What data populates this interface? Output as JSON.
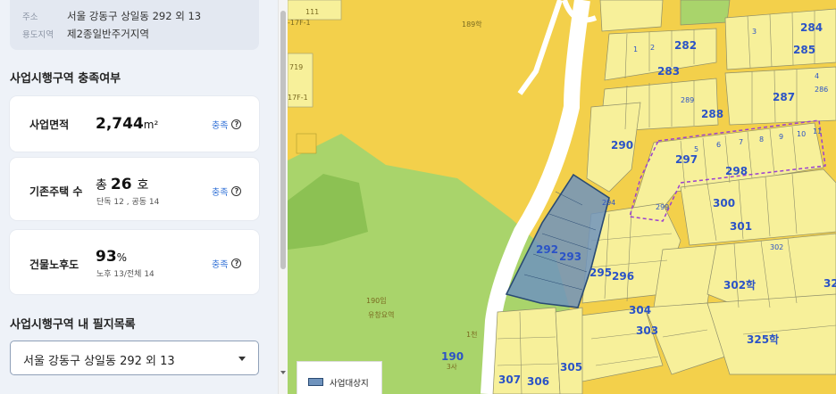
{
  "info": {
    "address_key": "주소",
    "address_value": "서울 강동구 상일동 292 외 13",
    "zoning_key": "용도지역",
    "zoning_value": "제2종일반주거지역"
  },
  "section1_title": "사업시행구역 충족여부",
  "stats": [
    {
      "label": "사업면적",
      "value": "2,744",
      "unit": "m²",
      "status": "충족"
    },
    {
      "label": "기존주택 수",
      "prefix": "총",
      "value": "26",
      "unit": "호",
      "sub": "단독 12 , 공동 14",
      "status": "충족"
    },
    {
      "label": "건물노후도",
      "value": "93",
      "unit": "%",
      "sub": "노후 13/전체 14",
      "status": "충족"
    }
  ],
  "help_glyph": "?",
  "section2_title": "사업시행구역 내 필지목록",
  "parcel_select": {
    "value": "서울 강동구 상일동 292 외 13"
  },
  "map": {
    "legend_label": "사업대상지",
    "colors": {
      "residential": "#f7f09a",
      "yellow_zone": "#f3d04b",
      "green_zone": "#a9d46b",
      "dark_green": "#8cc153",
      "road": "#ffffff",
      "target_fill": "#6f93bd",
      "target_border": "#294a73",
      "boundary": "#9b3fd1",
      "parcel_number": "#2b53c6"
    },
    "labels": {
      "lot_189": "189학",
      "lot_190": "190임",
      "lot_190_sub": "유창요역",
      "lot_190b": "190",
      "lot_190b_sub": "3사",
      "lot_111": "111",
      "lot_719": "719",
      "road_17f1": "-17F-1",
      "road_17f1b": "17F-1",
      "lot_1cheon": "1천",
      "lot_325": "325학",
      "lot_302": "302학",
      "big_numbers": [
        "284",
        "285",
        "282",
        "283",
        "287",
        "288",
        "290",
        "297",
        "298",
        "300",
        "301",
        "292",
        "293",
        "295",
        "296",
        "304",
        "303",
        "305",
        "306",
        "307",
        "325",
        "32"
      ],
      "small_numbers": [
        "1",
        "2",
        "3",
        "4",
        "5",
        "6",
        "7",
        "8",
        "9",
        "10",
        "11",
        "286",
        "289",
        "294",
        "299",
        "302"
      ]
    }
  }
}
